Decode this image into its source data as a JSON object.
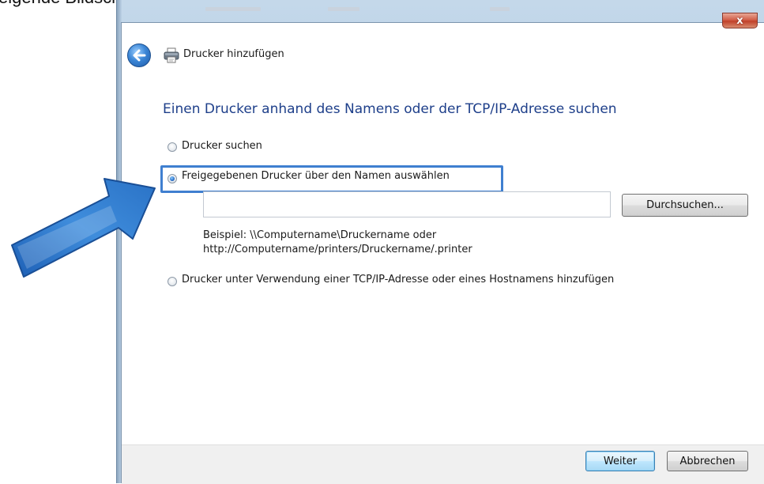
{
  "page_caption": "eigende Bildschirm wird angezeigt.",
  "window": {
    "close_glyph": "x",
    "header_title": "Drucker hinzufügen",
    "heading": "Einen Drucker anhand des Namens oder der TCP/IP-Adresse suchen"
  },
  "options": [
    {
      "label": "Drucker suchen",
      "checked": false
    },
    {
      "label": "Freigegebenen Drucker über den Namen auswählen",
      "checked": true
    },
    {
      "label": "Drucker unter Verwendung einer TCP/IP-Adresse oder eines Hostnamens hinzufügen",
      "checked": false
    }
  ],
  "printer_name_input": {
    "value": "",
    "placeholder": ""
  },
  "browse_button": "Durchsuchen...",
  "example": {
    "line1": "Beispiel: \\\\Computername\\Druckername oder",
    "line2": "http://Computername/printers/Druckername/.printer"
  },
  "footer": {
    "next_button": "Weiter",
    "cancel_button": "Abbrechen"
  },
  "colors": {
    "heading": "#1e3f8a",
    "highlight_border": "#3f7fd0",
    "arrow": "#2f74c8",
    "close_button": "#c9462f"
  },
  "icons": [
    "back-arrow-icon",
    "printer-icon",
    "close-icon",
    "pointer-arrow-icon"
  ]
}
